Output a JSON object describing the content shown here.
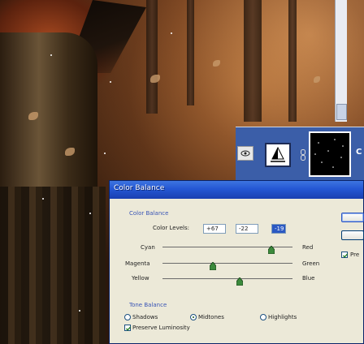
{
  "dialog": {
    "title": "Color Balance",
    "color_balance_group": "Color Balance",
    "color_levels_label": "Color Levels:",
    "levels": [
      "+67",
      "-22",
      "-19"
    ],
    "sliders": [
      {
        "left": "Cyan",
        "right": "Red",
        "value": 67
      },
      {
        "left": "Magenta",
        "right": "Green",
        "value": -22
      },
      {
        "left": "Yellow",
        "right": "Blue",
        "value": -19
      }
    ],
    "tone_balance_group": "Tone Balance",
    "tone_options": [
      "Shadows",
      "Midtones",
      "Highlights"
    ],
    "selected_tone": "Midtones",
    "preserve_luminosity": "Preserve Luminosity",
    "preserve_checked": true,
    "preview_label": "Pre"
  },
  "layers_panel": {
    "layer_name_fragment": "C"
  },
  "colors": {
    "title_bar": "#2457d4",
    "dialog_bg": "#ece9d8",
    "selected_layer": "#3b5ea8",
    "group_label": "#3a55b5"
  }
}
